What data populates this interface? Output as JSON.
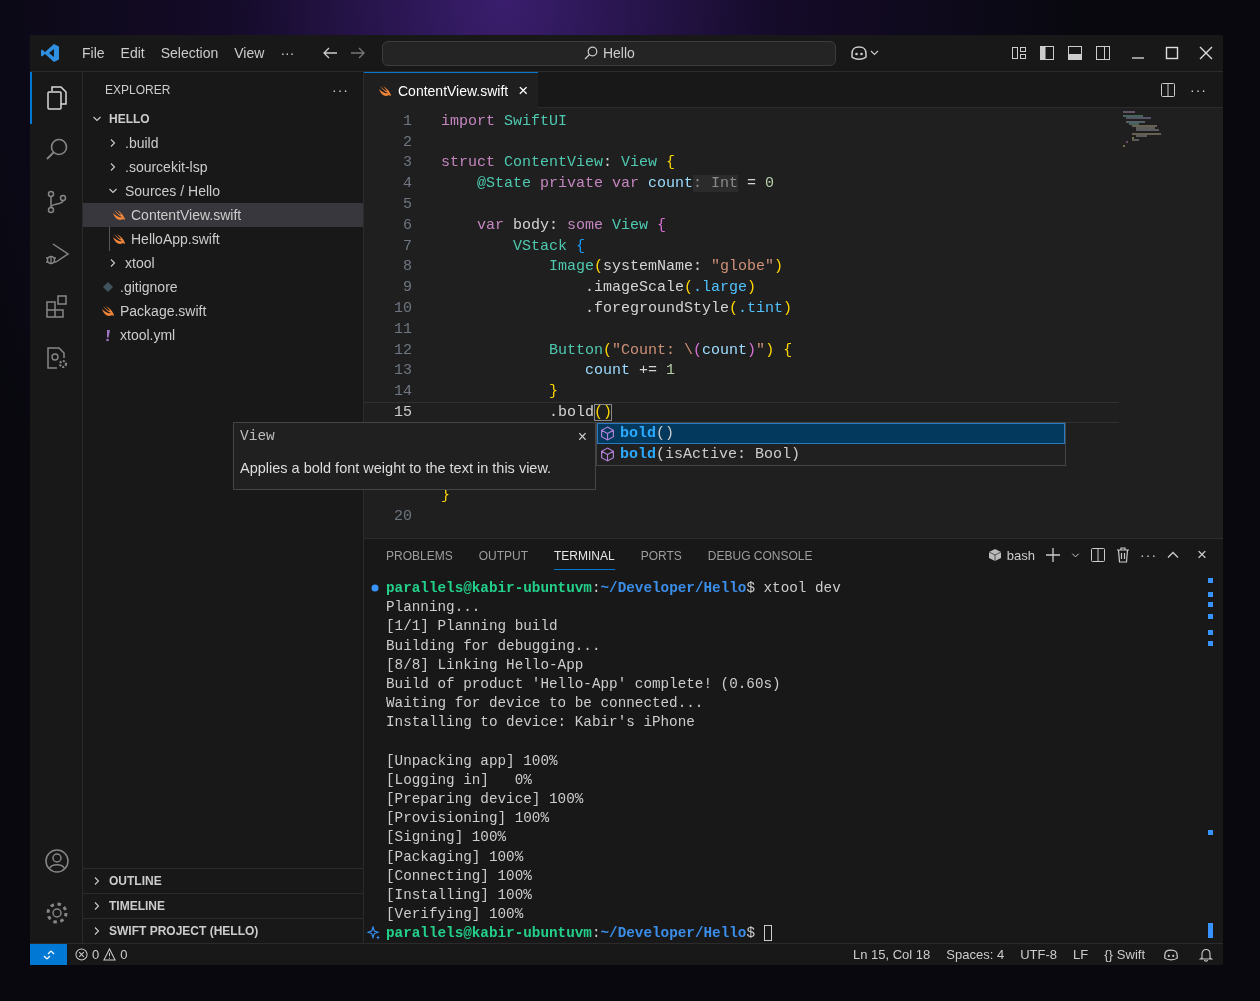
{
  "title_bar": {
    "menu": [
      "File",
      "Edit",
      "Selection",
      "View",
      "···"
    ],
    "search": "Hello"
  },
  "activity_bar": {
    "top": [
      {
        "kind": "files",
        "selected": true
      },
      {
        "kind": "search",
        "selected": false
      },
      {
        "kind": "branch",
        "selected": false
      },
      {
        "kind": "debug",
        "selected": false
      },
      {
        "kind": "blocks",
        "selected": false
      },
      {
        "kind": "doc-gear",
        "selected": false
      }
    ],
    "bottom": [
      {
        "kind": "account"
      },
      {
        "kind": "gear"
      }
    ]
  },
  "sidebar": {
    "title": "EXPLORER",
    "more": "···",
    "root": {
      "label": "HELLO",
      "expanded": true,
      "children": [
        {
          "label": ".build",
          "kind": "folder",
          "expanded": false,
          "selected": false
        },
        {
          "label": ".sourcekit-lsp",
          "kind": "folder",
          "expanded": false,
          "selected": false
        },
        {
          "label": "Sources / Hello",
          "kind": "folder",
          "expanded": true,
          "selected": false,
          "children": [
            {
              "label": "ContentView.swift",
              "kind": "swift",
              "selected": true
            },
            {
              "label": "HelloApp.swift",
              "kind": "swift",
              "selected": false
            }
          ]
        },
        {
          "label": "xtool",
          "kind": "folder",
          "expanded": false,
          "selected": false
        },
        {
          "label": ".gitignore",
          "kind": "git",
          "selected": false
        },
        {
          "label": "Package.swift",
          "kind": "swift",
          "selected": false
        },
        {
          "label": "xtool.yml",
          "kind": "yaml",
          "selected": false
        }
      ]
    },
    "sections": [
      {
        "label": "OUTLINE",
        "expanded": false
      },
      {
        "label": "TIMELINE",
        "expanded": false
      },
      {
        "label": "SWIFT PROJECT (HELLO)",
        "expanded": false
      }
    ]
  },
  "editor": {
    "tab": {
      "label": "ContentView.swift",
      "close": "×"
    },
    "more": "···",
    "lines": [
      {
        "number": "1",
        "current": false,
        "tokens": [
          {
            "kind": "kw",
            "text": "import "
          },
          {
            "kind": "type",
            "text": "SwiftUI"
          }
        ]
      },
      {
        "number": "2",
        "current": false
      },
      {
        "number": "3",
        "current": false,
        "tokens": [
          {
            "kind": "kw",
            "text": "struct "
          },
          {
            "kind": "type",
            "text": "ContentView"
          },
          {
            "kind": "plain",
            "text": ": "
          },
          {
            "kind": "type",
            "text": "View"
          },
          {
            "kind": "b1",
            "text": " {"
          }
        ]
      },
      {
        "number": "4",
        "current": false,
        "tokens": [
          {
            "kind": "attr",
            "text": "    @State"
          },
          {
            "kind": "kw",
            "text": " private var "
          },
          {
            "kind": "var",
            "text": "count"
          },
          {
            "kind": "hint",
            "text": ": Int"
          },
          {
            "kind": "plain",
            "text": " = "
          },
          {
            "kind": "num",
            "text": "0"
          }
        ]
      },
      {
        "number": "5",
        "current": false
      },
      {
        "number": "6",
        "current": false,
        "tokens": [
          {
            "kind": "kw",
            "text": "    var "
          },
          {
            "kind": "plain",
            "text": "body: "
          },
          {
            "kind": "kw",
            "text": "some "
          },
          {
            "kind": "type",
            "text": "View"
          },
          {
            "kind": "b2",
            "text": " {"
          }
        ]
      },
      {
        "number": "7",
        "current": false,
        "tokens": [
          {
            "kind": "type",
            "text": "        VStack"
          },
          {
            "kind": "b3",
            "text": " {"
          }
        ]
      },
      {
        "number": "8",
        "current": false,
        "tokens": [
          {
            "kind": "type",
            "text": "            Image"
          },
          {
            "kind": "b1",
            "text": "("
          },
          {
            "kind": "plain",
            "text": "systemName: "
          },
          {
            "kind": "str",
            "text": "\"globe\""
          },
          {
            "kind": "b1",
            "text": ")"
          }
        ]
      },
      {
        "number": "9",
        "current": false,
        "tokens": [
          {
            "kind": "plain",
            "text": "                .imageScale"
          },
          {
            "kind": "b1",
            "text": "("
          },
          {
            "kind": "prop",
            "text": ".large"
          },
          {
            "kind": "b1",
            "text": ")"
          }
        ]
      },
      {
        "number": "10",
        "current": false,
        "tokens": [
          {
            "kind": "plain",
            "text": "                .foregroundStyle"
          },
          {
            "kind": "b1",
            "text": "("
          },
          {
            "kind": "prop",
            "text": ".tint"
          },
          {
            "kind": "b1",
            "text": ")"
          }
        ]
      },
      {
        "number": "11",
        "current": false
      },
      {
        "number": "12",
        "current": false,
        "tokens": [
          {
            "kind": "type",
            "text": "            Button"
          },
          {
            "kind": "b1",
            "text": "("
          },
          {
            "kind": "str",
            "text": "\"Count: \\"
          },
          {
            "kind": "b2",
            "text": "("
          },
          {
            "kind": "var",
            "text": "count"
          },
          {
            "kind": "b2",
            "text": ")"
          },
          {
            "kind": "str",
            "text": "\""
          },
          {
            "kind": "b1",
            "text": ") {"
          }
        ]
      },
      {
        "number": "13",
        "current": false,
        "tokens": [
          {
            "kind": "var",
            "text": "                count"
          },
          {
            "kind": "plain",
            "text": " += "
          },
          {
            "kind": "num",
            "text": "1"
          }
        ]
      },
      {
        "number": "14",
        "current": false,
        "tokens": [
          {
            "kind": "b1",
            "text": "            }"
          }
        ]
      },
      {
        "number": "15",
        "current": true,
        "tokens": [
          {
            "kind": "plain",
            "text": "            .bold"
          },
          {
            "kind": "match",
            "text": "()"
          }
        ]
      },
      {
        "current": false,
        "tokens": [
          {
            "kind": "b1",
            "text": "}"
          }
        ]
      },
      {
        "number": "20",
        "current": false
      }
    ]
  },
  "hover": {
    "title": "View",
    "close": "×",
    "text": "Applies a bold font weight to the text in this view."
  },
  "suggestions": [
    {
      "match": "bold",
      "rest": "()",
      "selected": true
    },
    {
      "match": "bold",
      "rest": "(isActive: Bool)",
      "selected": false
    }
  ],
  "panel": {
    "tabs": [
      {
        "label": "PROBLEMS",
        "selected": false
      },
      {
        "label": "OUTPUT",
        "selected": false
      },
      {
        "label": "TERMINAL",
        "selected": true
      },
      {
        "label": "PORTS",
        "selected": false
      },
      {
        "label": "DEBUG CONSOLE",
        "selected": false
      }
    ],
    "profile": "bash",
    "more": "···",
    "close": "×",
    "terminal": [
      {
        "kind": "finished",
        "user": "parallels@kabir-ubuntuvm",
        "separator": ":",
        "path": "~/Developer/Hello",
        "command": "$ xtool dev"
      },
      {
        "kind": "output",
        "text": "Planning..."
      },
      {
        "kind": "output",
        "text": "[1/1] Planning build"
      },
      {
        "kind": "output",
        "text": "Building for debugging..."
      },
      {
        "kind": "output",
        "text": "[8/8] Linking Hello-App"
      },
      {
        "kind": "output",
        "text": "Build of product 'Hello-App' complete! (0.60s)"
      },
      {
        "kind": "output",
        "text": "Waiting for device to be connected..."
      },
      {
        "kind": "output",
        "text": "Installing to device: Kabir's iPhone"
      },
      {
        "kind": "blank"
      },
      {
        "kind": "output",
        "text": "[Unpacking app] 100%"
      },
      {
        "kind": "output",
        "text": "[Logging in]   0%"
      },
      {
        "kind": "output",
        "text": "[Preparing device] 100%"
      },
      {
        "kind": "output",
        "text": "[Provisioning] 100%"
      },
      {
        "kind": "output",
        "text": "[Signing] 100%"
      },
      {
        "kind": "output",
        "text": "[Packaging] 100%"
      },
      {
        "kind": "output",
        "text": "[Connecting] 100%"
      },
      {
        "kind": "output",
        "text": "[Installing] 100%"
      },
      {
        "kind": "output",
        "text": "[Verifying] 100%"
      },
      {
        "kind": "active",
        "user": "parallels@kabir-ubuntuvm",
        "separator": ":",
        "path": "~/Developer/Hello",
        "command": "$"
      }
    ]
  },
  "status_bar": {
    "errors": "0",
    "warnings": "0",
    "items": [
      "Ln 15, Col 18",
      "Spaces: 4",
      "UTF-8",
      "LF"
    ],
    "language": {
      "icon": "{}",
      "label": "Swift"
    }
  }
}
